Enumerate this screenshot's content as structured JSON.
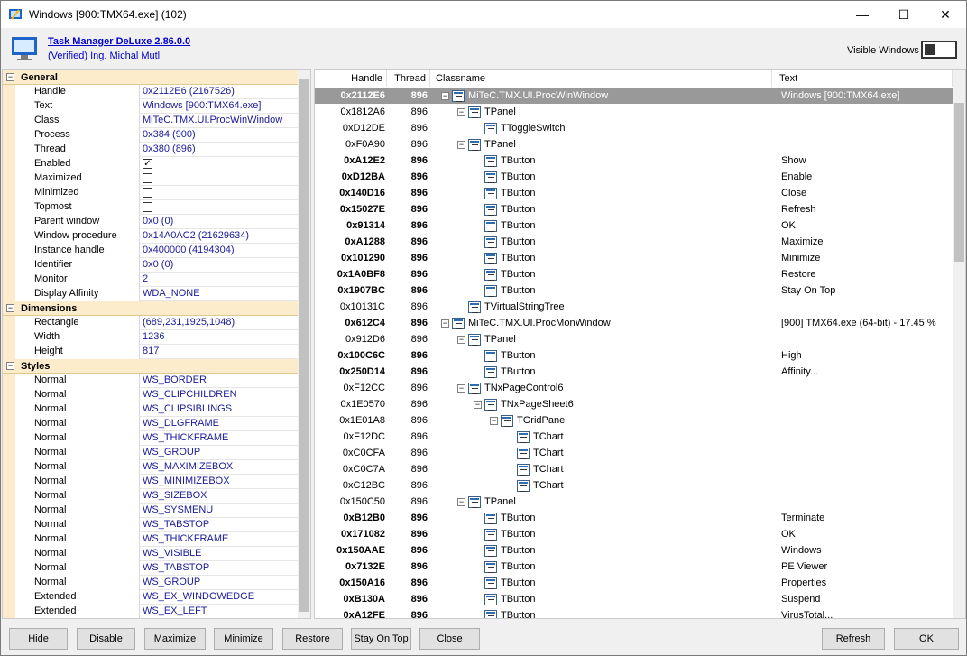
{
  "window": {
    "title": "Windows [900:TMX64.exe] (102)",
    "minimize": "—",
    "maximize": "☐",
    "close": "✕"
  },
  "header": {
    "app_name": "Task Manager DeLuxe 2.86.0.0",
    "publisher": "(Verified) Ing. Michal Mutl",
    "toggle_label": "Visible Windows"
  },
  "properties": {
    "general": {
      "label": "General",
      "rows": [
        {
          "k": "Handle",
          "v": "0x2112E6 (2167526)"
        },
        {
          "k": "Text",
          "v": "Windows [900:TMX64.exe]"
        },
        {
          "k": "Class",
          "v": "MiTeC.TMX.UI.ProcWinWindow"
        },
        {
          "k": "Process",
          "v": "0x384 (900)"
        },
        {
          "k": "Thread",
          "v": "0x380 (896)"
        },
        {
          "k": "Enabled",
          "check": true
        },
        {
          "k": "Maximized",
          "check": false
        },
        {
          "k": "Minimized",
          "check": false
        },
        {
          "k": "Topmost",
          "check": false
        },
        {
          "k": "Parent window",
          "v": "0x0 (0)"
        },
        {
          "k": "Window procedure",
          "v": "0x14A0AC2 (21629634)"
        },
        {
          "k": "Instance handle",
          "v": "0x400000 (4194304)"
        },
        {
          "k": "Identifier",
          "v": "0x0 (0)"
        },
        {
          "k": "Monitor",
          "v": "2"
        },
        {
          "k": "Display Affinity",
          "v": "WDA_NONE"
        }
      ]
    },
    "dimensions": {
      "label": "Dimensions",
      "rows": [
        {
          "k": "Rectangle",
          "v": "(689,231,1925,1048)"
        },
        {
          "k": "Width",
          "v": "1236"
        },
        {
          "k": "Height",
          "v": "817"
        }
      ]
    },
    "styles": {
      "label": "Styles",
      "rows": [
        {
          "k": "Normal",
          "v": "WS_BORDER"
        },
        {
          "k": "Normal",
          "v": "WS_CLIPCHILDREN"
        },
        {
          "k": "Normal",
          "v": "WS_CLIPSIBLINGS"
        },
        {
          "k": "Normal",
          "v": "WS_DLGFRAME"
        },
        {
          "k": "Normal",
          "v": "WS_THICKFRAME"
        },
        {
          "k": "Normal",
          "v": "WS_GROUP"
        },
        {
          "k": "Normal",
          "v": "WS_MAXIMIZEBOX"
        },
        {
          "k": "Normal",
          "v": "WS_MINIMIZEBOX"
        },
        {
          "k": "Normal",
          "v": "WS_SIZEBOX"
        },
        {
          "k": "Normal",
          "v": "WS_SYSMENU"
        },
        {
          "k": "Normal",
          "v": "WS_TABSTOP"
        },
        {
          "k": "Normal",
          "v": "WS_THICKFRAME"
        },
        {
          "k": "Normal",
          "v": "WS_VISIBLE"
        },
        {
          "k": "Normal",
          "v": "WS_TABSTOP"
        },
        {
          "k": "Normal",
          "v": "WS_GROUP"
        },
        {
          "k": "Extended",
          "v": "WS_EX_WINDOWEDGE"
        },
        {
          "k": "Extended",
          "v": "WS_EX_LEFT"
        }
      ]
    }
  },
  "tree": {
    "columns": [
      "Handle",
      "Thread",
      "Classname",
      "Text"
    ],
    "rows": [
      {
        "h": "0x2112E6",
        "t": "896",
        "c": "MiTeC.TMX.UI.ProcWinWindow",
        "x": "Windows [900:TMX64.exe]",
        "d": 0,
        "b": true,
        "sel": true,
        "exp": true
      },
      {
        "h": "0x1812A6",
        "t": "896",
        "c": "TPanel",
        "x": "",
        "d": 1,
        "b": false,
        "exp": true
      },
      {
        "h": "0xD12DE",
        "t": "896",
        "c": "TToggleSwitch",
        "x": "",
        "d": 2,
        "b": false
      },
      {
        "h": "0xF0A90",
        "t": "896",
        "c": "TPanel",
        "x": "",
        "d": 1,
        "b": false,
        "exp": true
      },
      {
        "h": "0xA12E2",
        "t": "896",
        "c": "TButton",
        "x": "Show",
        "d": 2,
        "b": true
      },
      {
        "h": "0xD12BA",
        "t": "896",
        "c": "TButton",
        "x": "Enable",
        "d": 2,
        "b": true
      },
      {
        "h": "0x140D16",
        "t": "896",
        "c": "TButton",
        "x": "Close",
        "d": 2,
        "b": true
      },
      {
        "h": "0x15027E",
        "t": "896",
        "c": "TButton",
        "x": "Refresh",
        "d": 2,
        "b": true
      },
      {
        "h": "0x91314",
        "t": "896",
        "c": "TButton",
        "x": "OK",
        "d": 2,
        "b": true
      },
      {
        "h": "0xA1288",
        "t": "896",
        "c": "TButton",
        "x": "Maximize",
        "d": 2,
        "b": true
      },
      {
        "h": "0x101290",
        "t": "896",
        "c": "TButton",
        "x": "Minimize",
        "d": 2,
        "b": true
      },
      {
        "h": "0x1A0BF8",
        "t": "896",
        "c": "TButton",
        "x": "Restore",
        "d": 2,
        "b": true
      },
      {
        "h": "0x1907BC",
        "t": "896",
        "c": "TButton",
        "x": "Stay On Top",
        "d": 2,
        "b": true
      },
      {
        "h": "0x10131C",
        "t": "896",
        "c": "TVirtualStringTree",
        "x": "",
        "d": 1,
        "b": false
      },
      {
        "h": "0x612C4",
        "t": "896",
        "c": "MiTeC.TMX.UI.ProcMonWindow",
        "x": "[900] TMX64.exe (64-bit) - 17.45 %",
        "d": 0,
        "b": true,
        "exp": true
      },
      {
        "h": "0x912D6",
        "t": "896",
        "c": "TPanel",
        "x": "",
        "d": 1,
        "b": false,
        "exp": true
      },
      {
        "h": "0x100C6C",
        "t": "896",
        "c": "TButton",
        "x": "High",
        "d": 2,
        "b": true
      },
      {
        "h": "0x250D14",
        "t": "896",
        "c": "TButton",
        "x": "Affinity...",
        "d": 2,
        "b": true
      },
      {
        "h": "0xF12CC",
        "t": "896",
        "c": "TNxPageControl6",
        "x": "",
        "d": 1,
        "b": false,
        "exp": true
      },
      {
        "h": "0x1E0570",
        "t": "896",
        "c": "TNxPageSheet6",
        "x": "",
        "d": 2,
        "b": false,
        "exp": true
      },
      {
        "h": "0x1E01A8",
        "t": "896",
        "c": "TGridPanel",
        "x": "",
        "d": 3,
        "b": false,
        "exp": true
      },
      {
        "h": "0xF12DC",
        "t": "896",
        "c": "TChart",
        "x": "",
        "d": 4,
        "b": false
      },
      {
        "h": "0xC0CFA",
        "t": "896",
        "c": "TChart",
        "x": "",
        "d": 4,
        "b": false
      },
      {
        "h": "0xC0C7A",
        "t": "896",
        "c": "TChart",
        "x": "",
        "d": 4,
        "b": false
      },
      {
        "h": "0xC12BC",
        "t": "896",
        "c": "TChart",
        "x": "",
        "d": 4,
        "b": false
      },
      {
        "h": "0x150C50",
        "t": "896",
        "c": "TPanel",
        "x": "",
        "d": 1,
        "b": false,
        "exp": true
      },
      {
        "h": "0xB12B0",
        "t": "896",
        "c": "TButton",
        "x": "Terminate",
        "d": 2,
        "b": true
      },
      {
        "h": "0x171082",
        "t": "896",
        "c": "TButton",
        "x": "OK",
        "d": 2,
        "b": true
      },
      {
        "h": "0x150AAE",
        "t": "896",
        "c": "TButton",
        "x": "Windows",
        "d": 2,
        "b": true
      },
      {
        "h": "0x7132E",
        "t": "896",
        "c": "TButton",
        "x": "PE Viewer",
        "d": 2,
        "b": true
      },
      {
        "h": "0x150A16",
        "t": "896",
        "c": "TButton",
        "x": "Properties",
        "d": 2,
        "b": true
      },
      {
        "h": "0xB130A",
        "t": "896",
        "c": "TButton",
        "x": "Suspend",
        "d": 2,
        "b": true
      },
      {
        "h": "0xA12FE",
        "t": "896",
        "c": "TButton",
        "x": "VirusTotal...",
        "d": 2,
        "b": true
      }
    ]
  },
  "buttons": {
    "hide": "Hide",
    "disable": "Disable",
    "maximize": "Maximize",
    "minimize": "Minimize",
    "restore": "Restore",
    "stay_on_top": "Stay On Top",
    "close": "Close",
    "refresh": "Refresh",
    "ok": "OK"
  }
}
